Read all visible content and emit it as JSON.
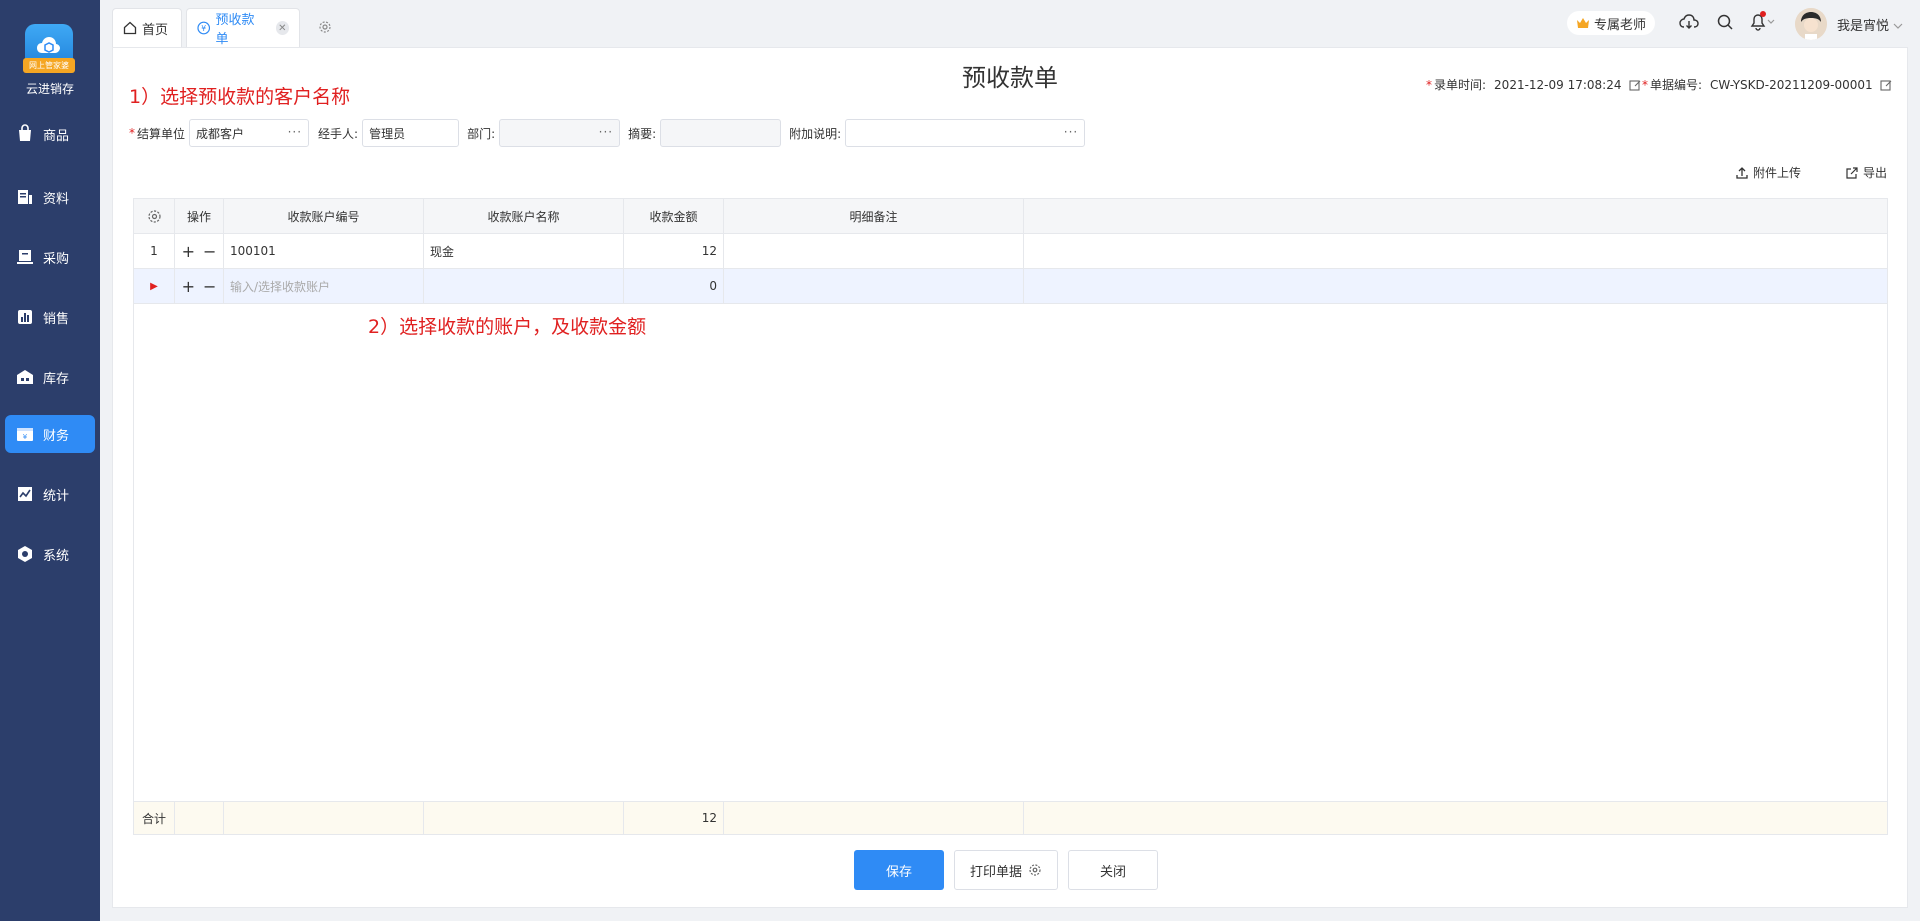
{
  "sidebar": {
    "logo_badge": "网上管家婆",
    "app_name": "云进销存",
    "items": [
      {
        "label": "商品",
        "icon": "bag-icon"
      },
      {
        "label": "资料",
        "icon": "document-icon"
      },
      {
        "label": "采购",
        "icon": "purchase-icon"
      },
      {
        "label": "销售",
        "icon": "chart-bar-icon"
      },
      {
        "label": "库存",
        "icon": "warehouse-icon"
      },
      {
        "label": "财务",
        "icon": "wallet-icon",
        "active": true
      },
      {
        "label": "统计",
        "icon": "trend-icon"
      },
      {
        "label": "系统",
        "icon": "settings-hex-icon"
      }
    ]
  },
  "tabs": {
    "home": "首页",
    "active": "预收款单",
    "close": "✕"
  },
  "header": {
    "teacher": "专属老师",
    "username": "我是宵悦"
  },
  "page": {
    "title": "预收款单",
    "annotation1": "1）选择预收款的客户名称",
    "annotation2": "2）选择收款的账户，及收款金额",
    "entry_time_label": "录单时间:",
    "entry_time": "2021-12-09 17:08:24",
    "doc_no_label": "单据编号:",
    "doc_no": "CW-YSKD-20211209-00001"
  },
  "form": {
    "settle_unit_label": "结算单位",
    "settle_unit": "成都客户",
    "handler_label": "经手人:",
    "handler": "管理员",
    "dept_label": "部门:",
    "dept": "",
    "summary_label": "摘要:",
    "summary": "",
    "remark_label": "附加说明:",
    "remark": "",
    "dots": "···"
  },
  "actions": {
    "upload": "附件上传",
    "export": "导出"
  },
  "grid": {
    "columns": [
      "操作",
      "收款账户编号",
      "收款账户名称",
      "收款金额",
      "明细备注"
    ],
    "rows": [
      {
        "index": "1",
        "account_no": "100101",
        "account_name": "现金",
        "amount": "12",
        "note": ""
      }
    ],
    "new_row": {
      "placeholder": "输入/选择收款账户",
      "amount": "0"
    },
    "footer": {
      "label": "合计",
      "amount": "12"
    }
  },
  "buttons": {
    "save": "保存",
    "print": "打印单据",
    "close": "关闭"
  },
  "colors": {
    "sidebar": "#2c3e6b",
    "accent": "#2f8bf5",
    "annotation": "#e02020"
  }
}
